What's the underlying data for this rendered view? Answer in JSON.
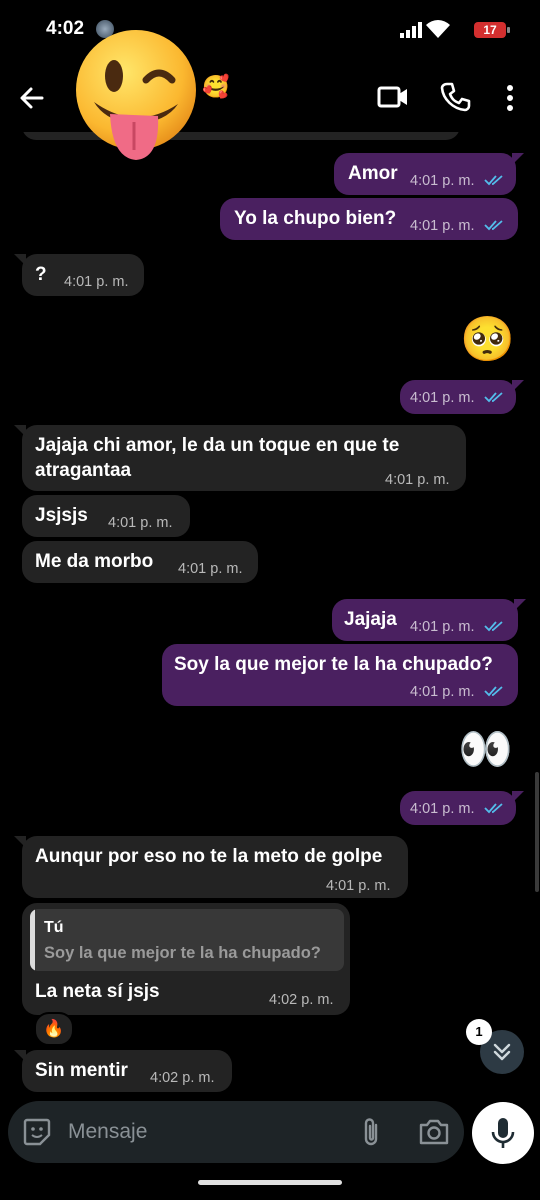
{
  "status_bar": {
    "time": "4:02",
    "battery": "17"
  },
  "header": {
    "title_emoji": "🥰",
    "sticker_icon": "winking-tongue-out-face-sticker"
  },
  "messages": [
    {
      "dir": "out",
      "text": "Amor",
      "time": "4:01 p. m."
    },
    {
      "dir": "out",
      "text": "Yo la chupo bien?",
      "time": "4:01 p. m."
    },
    {
      "dir": "in",
      "text": "?",
      "time": "4:01 p. m."
    },
    {
      "dir": "out",
      "emoji": "🥺",
      "time": "4:01 p. m."
    },
    {
      "dir": "in",
      "text_line1": "Jajaja chi amor, le da un toque en que te",
      "text_line2": "atragantaa",
      "time": "4:01 p. m."
    },
    {
      "dir": "in",
      "text": "Jsjsjs",
      "time": "4:01 p. m."
    },
    {
      "dir": "in",
      "text": "Me da morbo",
      "time": "4:01 p. m."
    },
    {
      "dir": "out",
      "text": "Jajaja",
      "time": "4:01 p. m."
    },
    {
      "dir": "out",
      "text": "Soy la que mejor te la ha chupado?",
      "time": "4:01 p. m."
    },
    {
      "dir": "out",
      "emoji": "👀",
      "time": "4:01 p. m."
    },
    {
      "dir": "in",
      "text": "Aunqur por eso no te la meto de golpe",
      "time": "4:01 p. m."
    },
    {
      "dir": "in",
      "quote_author": "Tú",
      "quote_text": "Soy la que mejor te la ha chupado?",
      "text": "La neta sí jsjs",
      "time": "4:02 p. m.",
      "reaction": "🔥"
    },
    {
      "dir": "in",
      "text": "Sin mentir",
      "time": "4:02 p. m."
    }
  ],
  "unread_count": "1",
  "composer": {
    "placeholder": "Mensaje"
  },
  "colors": {
    "incoming_bubble": "#232323",
    "outgoing_bubble": "#4a2060",
    "read_ticks": "#53bdeb"
  }
}
